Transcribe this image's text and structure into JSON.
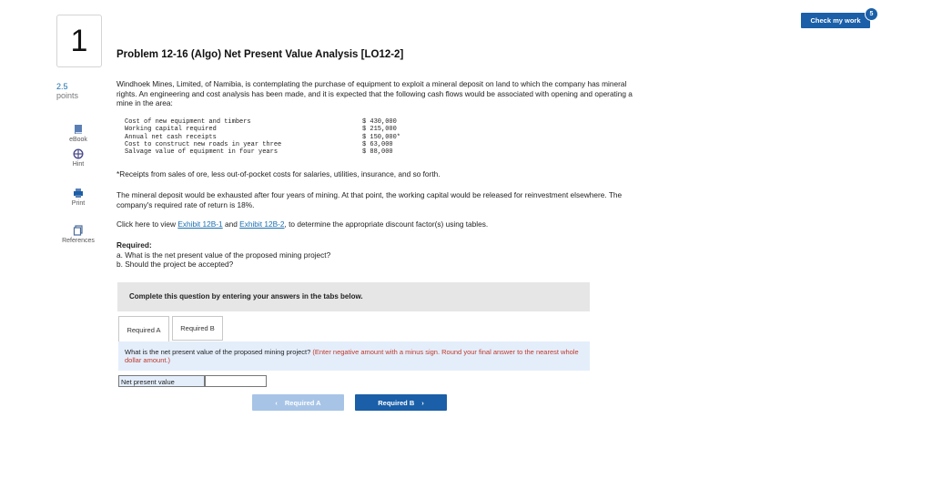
{
  "question": {
    "number": "1",
    "points_value": "2.5",
    "points_label": "points"
  },
  "sidebar": {
    "items": [
      {
        "label": "eBook",
        "icon": "book-icon"
      },
      {
        "label": "Hint",
        "icon": "hint-icon"
      },
      {
        "label": "Print",
        "icon": "print-icon"
      },
      {
        "label": "References",
        "icon": "references-icon"
      }
    ]
  },
  "header": {
    "check_label": "Check my work",
    "check_badge": "5"
  },
  "problem": {
    "title": "Problem 12-16 (Algo) Net Present Value Analysis [LO12-2]",
    "intro": "Windhoek Mines, Limited, of Namibia, is contemplating the purchase of equipment to exploit a mineral deposit on land to which the company has mineral rights. An engineering and cost analysis has been made, and it is expected that the following cash flows would be associated with opening and operating a mine in the area:",
    "cash_flows": [
      {
        "label": "Cost of new equipment and timbers",
        "value": "$ 430,000"
      },
      {
        "label": "Working capital required",
        "value": "$ 215,000"
      },
      {
        "label": "Annual net cash receipts",
        "value": "$ 150,000*"
      },
      {
        "label": "Cost to construct new roads in year three",
        "value": "$ 63,000"
      },
      {
        "label": "Salvage value of equipment in four years",
        "value": "$ 88,000"
      }
    ],
    "footnote": "*Receipts from sales of ore, less out-of-pocket costs for salaries, utilities, insurance, and so forth.",
    "paragraph2": "The mineral deposit would be exhausted after four years of mining. At that point, the working capital would be released for reinvestment elsewhere. The company's required rate of return is 18%.",
    "exhibit": {
      "prefix": "Click here to view ",
      "link1": "Exhibit 12B-1",
      "and": " and ",
      "link2": "Exhibit 12B-2",
      "suffix": ", to determine the appropriate discount factor(s) using tables."
    },
    "required_heading": "Required:",
    "required_a": "a. What is the net present value of the proposed mining project?",
    "required_b": "b. Should the project be accepted?"
  },
  "tabs": {
    "instruction": "Complete this question by entering your answers in the tabs below.",
    "items": [
      "Required A",
      "Required B"
    ],
    "active": "Required A"
  },
  "answer": {
    "question": "What is the net present value of the proposed mining project?",
    "hint": "(Enter negative amount with a minus sign. Round your final answer to the nearest whole dollar amount.)",
    "field_label": "Net present value",
    "field_value": ""
  },
  "nav": {
    "prev_label": "Required A",
    "next_label": "Required B"
  },
  "colors": {
    "primary": "#1a5fa8",
    "disabled": "#a7c4e6",
    "answer_bg": "#e4eefb",
    "hint_red": "#c0392b"
  }
}
